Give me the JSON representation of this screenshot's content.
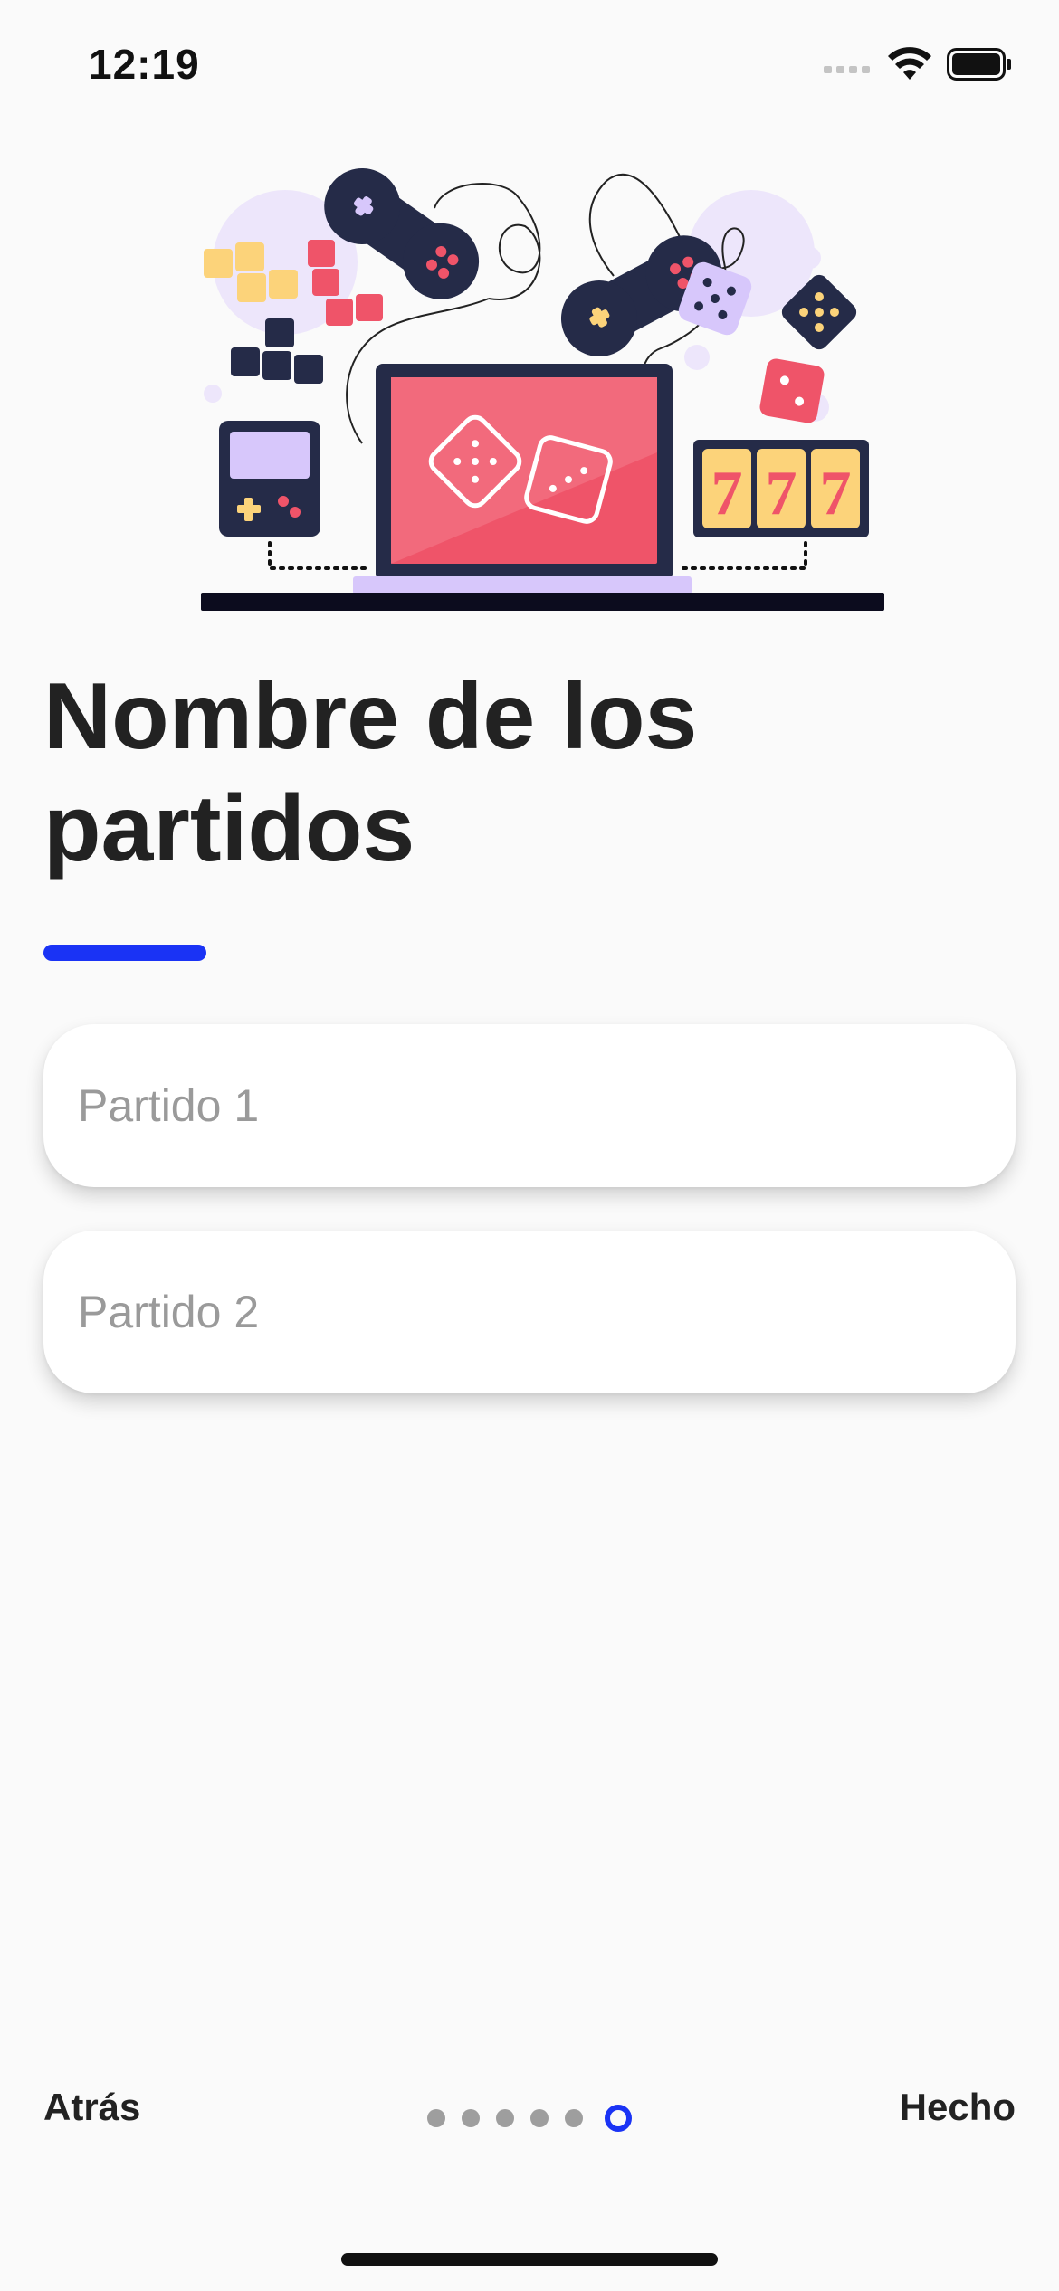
{
  "status_bar": {
    "time": "12:19",
    "icons": [
      "cellular-signal-icon",
      "wifi-icon",
      "battery-icon"
    ]
  },
  "illustration": {
    "name": "gaming-illustration",
    "slot_symbols": [
      "7",
      "7",
      "7"
    ]
  },
  "title": "Nombre de los partidos",
  "fields": [
    {
      "placeholder": "Partido 1",
      "value": ""
    },
    {
      "placeholder": "Partido 2",
      "value": ""
    }
  ],
  "nav": {
    "back_label": "Atrás",
    "done_label": "Hecho",
    "total_steps": 6,
    "current_step": 6
  },
  "colors": {
    "accent": "#1a33f5",
    "background": "#fafafa",
    "text": "#222222",
    "dot_inactive": "#9e9e9e"
  }
}
